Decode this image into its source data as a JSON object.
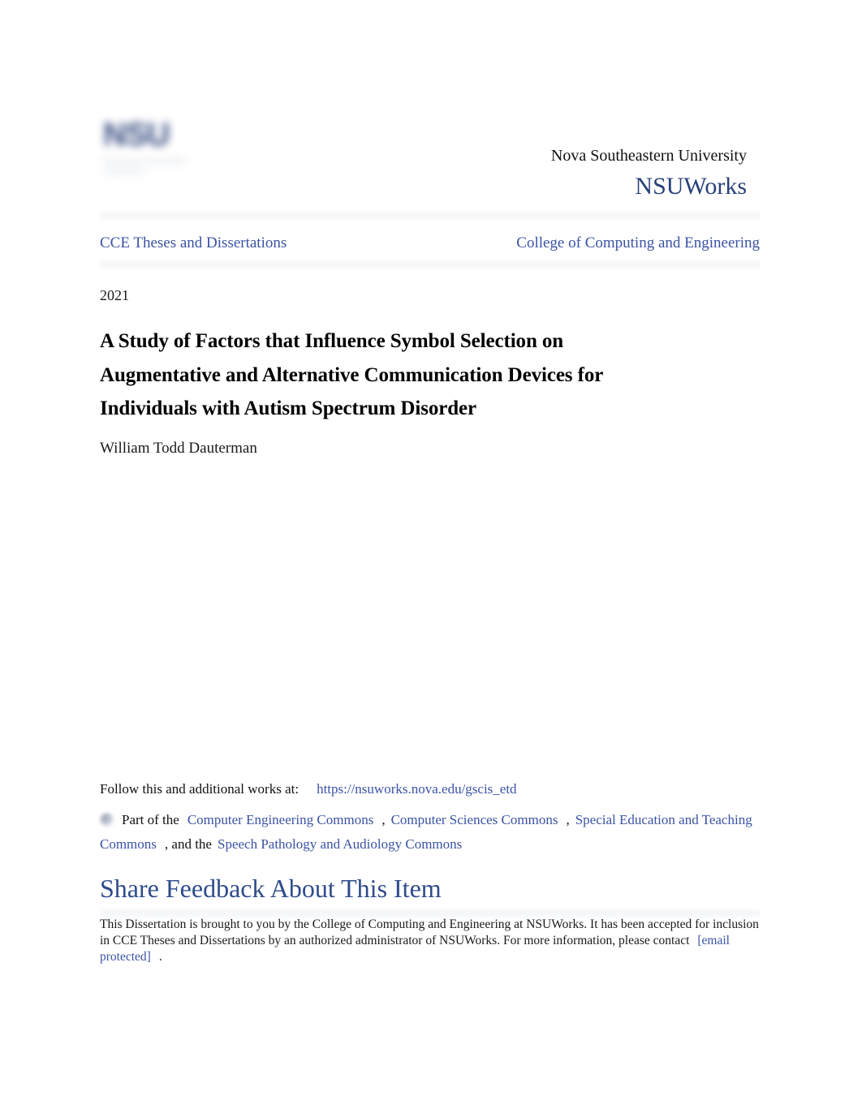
{
  "header": {
    "logo_mark": "NSU",
    "logo_sub": "NOVA SOUTHEASTERN UNIVERSITY",
    "university": "Nova Southeastern University",
    "repository": "NSUWorks"
  },
  "breadcrumbs": {
    "left": "CCE Theses and Dissertations",
    "right": "College of Computing and Engineering"
  },
  "record": {
    "year": "2021",
    "title": "A Study of Factors that Influence Symbol Selection on Augmentative and Alternative Communication Devices for Individuals with Autism Spectrum Disorder",
    "author": "William Todd Dauterman"
  },
  "follow": {
    "label": "Follow this and additional works at:",
    "url": "https://nsuworks.nova.edu/gscis_etd"
  },
  "disciplines": {
    "prefix": "Part of the",
    "icon": "commons-disciplines-icon",
    "links": [
      "Computer Engineering Commons",
      "Computer Sciences Commons",
      "Special Education and Teaching Commons",
      "Speech Pathology and Audiology Commons"
    ],
    "separator": ",",
    "conjunction": ", and the"
  },
  "feedback": {
    "label": "Share Feedback About This Item"
  },
  "footer": {
    "text_1": "This Dissertation is brought to you by the College of Computing and Engineering at NSUWorks. It has been accepted for inclusion in CCE Theses and Dissertations by an authorized administrator of NSUWorks. For more information, please contact",
    "email_link": "[email protected]",
    "text_2": "."
  },
  "colors": {
    "link_blue": "#3a53a4",
    "brand_navy": "#27417a",
    "heading_navy": "#2f4b8c",
    "band_gray": "#f6f7f9",
    "text_black": "#111111"
  }
}
